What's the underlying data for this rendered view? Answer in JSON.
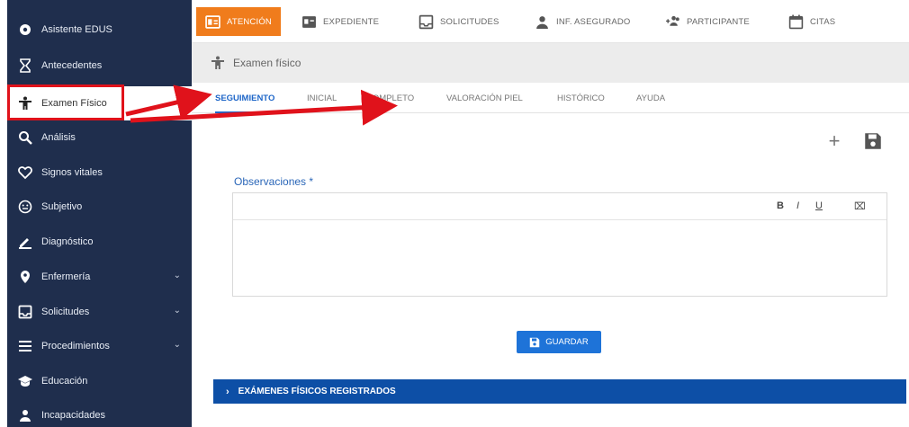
{
  "sidebar": {
    "items": [
      {
        "label": "Asistente EDUS",
        "icon": "gear-icon"
      },
      {
        "label": "Antecedentes",
        "icon": "hourglass-icon"
      },
      {
        "label": "Examen Físico",
        "icon": "person-icon"
      },
      {
        "label": "Análisis",
        "icon": "magnifier-icon"
      },
      {
        "label": "Signos vitales",
        "icon": "heart-icon"
      },
      {
        "label": "Subjetivo",
        "icon": "face-icon"
      },
      {
        "label": "Diagnóstico",
        "icon": "pencil-icon"
      },
      {
        "label": "Enfermería",
        "icon": "map-pin-icon"
      },
      {
        "label": "Solicitudes",
        "icon": "inbox-icon"
      },
      {
        "label": "Procedimientos",
        "icon": "list-icon"
      },
      {
        "label": "Educación",
        "icon": "graduation-cap-icon"
      },
      {
        "label": "Incapacidades",
        "icon": "person-outline-icon"
      }
    ]
  },
  "topbar": {
    "tabs": [
      {
        "label": "ATENCIÓN",
        "icon": "id-card-icon"
      },
      {
        "label": "EXPEDIENTE",
        "icon": "folder-card-icon"
      },
      {
        "label": "SOLICITUDES",
        "icon": "inbox-icon"
      },
      {
        "label": "INF. ASEGURADO",
        "icon": "person-icon"
      },
      {
        "label": "PARTICIPANTE",
        "icon": "group-add-icon"
      },
      {
        "label": "CITAS",
        "icon": "calendar-icon"
      }
    ]
  },
  "section": {
    "title": "Examen físico"
  },
  "subtabs": [
    "SEGUIMIENTO",
    "INICIAL",
    "COMPLETO",
    "VALORACIÓN PIEL",
    "HISTÓRICO",
    "AYUDA"
  ],
  "form": {
    "observations_label": "Observaciones *",
    "format_bold": "B",
    "format_italic": "I",
    "format_underline": "U",
    "format_clear": "⌧",
    "save_button": "GUARDAR"
  },
  "registered": {
    "label": "EXÁMENES FÍSICOS REGISTRADOS"
  },
  "colors": {
    "sidebar_bg": "#1f2e4d",
    "active_tab": "#f07c1c",
    "primary_blue": "#1e73d8",
    "annotation_red": "#e0121b"
  }
}
